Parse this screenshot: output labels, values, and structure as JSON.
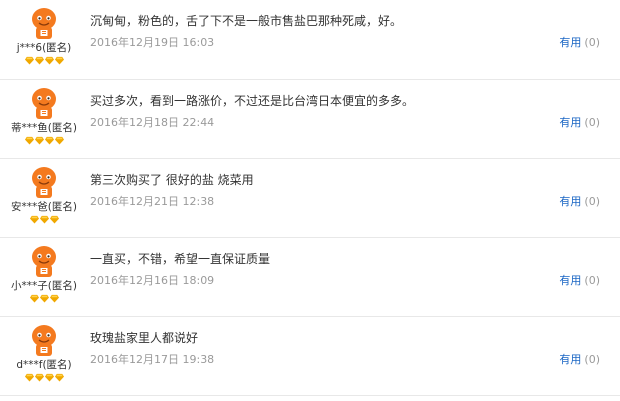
{
  "colors": {
    "avatar_orange": "#f47a1f",
    "diamond_gold": "#f0a800",
    "link_blue": "#1a66c4",
    "date_gray": "#9a9a9a",
    "divider": "#e8e8e8"
  },
  "reviews": [
    {
      "username": "j***6(匿名)",
      "avatar_icon": "orange-mascot-avatar",
      "level_diamonds": 4,
      "comment": "沉甸甸，粉色的，舌了下不是一般市售盐巴那种死咸，好。",
      "date": "2016年12月19日 16:03",
      "useful_label": "有用",
      "useful_count": "(0)"
    },
    {
      "username": "蒂***鱼(匿名)",
      "avatar_icon": "orange-mascot-avatar",
      "level_diamonds": 4,
      "comment": "买过多次，看到一路涨价，不过还是比台湾日本便宜的多多。",
      "date": "2016年12月18日 22:44",
      "useful_label": "有用",
      "useful_count": "(0)"
    },
    {
      "username": "安***爸(匿名)",
      "avatar_icon": "orange-mascot-avatar",
      "level_diamonds": 3,
      "comment": "第三次购买了 很好的盐 烧菜用",
      "date": "2016年12月21日 12:38",
      "useful_label": "有用",
      "useful_count": "(0)"
    },
    {
      "username": "小***子(匿名)",
      "avatar_icon": "orange-mascot-avatar",
      "level_diamonds": 3,
      "comment": "一直买，不错，希望一直保证质量",
      "date": "2016年12月16日 18:09",
      "useful_label": "有用",
      "useful_count": "(0)"
    },
    {
      "username": "d***f(匿名)",
      "avatar_icon": "orange-mascot-avatar",
      "level_diamonds": 4,
      "comment": "玫瑰盐家里人都说好",
      "date": "2016年12月17日 19:38",
      "useful_label": "有用",
      "useful_count": "(0)"
    }
  ]
}
